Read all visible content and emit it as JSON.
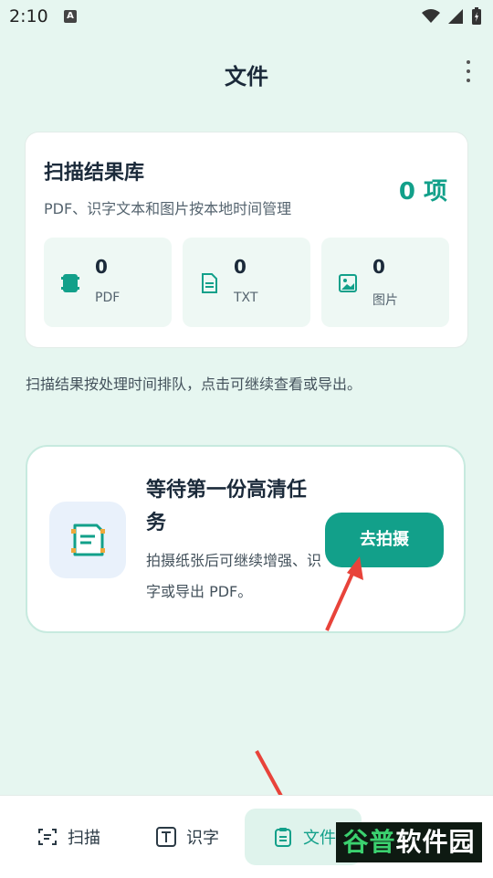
{
  "status_bar": {
    "time": "2:10",
    "badge": "A"
  },
  "app_bar": {
    "title": "文件"
  },
  "summary": {
    "title": "扫描结果库",
    "subtitle": "PDF、识字文本和图片按本地时间管理",
    "count": "0 项",
    "stats": [
      {
        "value": "0",
        "label": "PDF",
        "icon": "pdf-book-icon"
      },
      {
        "value": "0",
        "label": "TXT",
        "icon": "document-icon"
      },
      {
        "value": "0",
        "label": "图片",
        "icon": "image-icon"
      }
    ]
  },
  "info_text": "扫描结果按处理时间排队，点击可继续查看或导出。",
  "empty_state": {
    "title": "等待第一份高清任务",
    "subtitle": "拍摄纸张后可继续增强、识字或导出 PDF。",
    "button": "去拍摄",
    "icon": "scan-document-icon"
  },
  "bottom_nav": {
    "items": [
      {
        "label": "扫描",
        "icon": "scan-icon",
        "active": false
      },
      {
        "label": "识字",
        "icon": "text-recognition-icon",
        "active": false
      },
      {
        "label": "文件",
        "icon": "clipboard-icon",
        "active": true
      }
    ]
  },
  "watermark": {
    "accent": "谷普",
    "text": "软件园"
  },
  "colors": {
    "accent": "#12a08a",
    "background": "#e6f6f0",
    "arrow": "#e8433a"
  }
}
